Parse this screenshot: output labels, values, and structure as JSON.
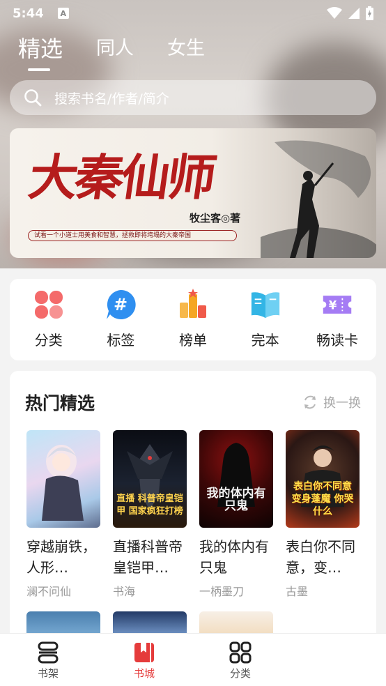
{
  "status_bar": {
    "time": "5:44",
    "notification_icon": "A"
  },
  "top_tabs": [
    {
      "label": "精选",
      "active": true
    },
    {
      "label": "同人",
      "active": false
    },
    {
      "label": "女生",
      "active": false
    }
  ],
  "search": {
    "placeholder": "搜索书名/作者/简介"
  },
  "banner": {
    "title": "大秦仙师",
    "author": "牧尘客◎著",
    "slogan": "试看一个小道士用美食和智慧，拯救即将垮塌的大秦帝国"
  },
  "quick_entries": [
    {
      "label": "分类",
      "icon": "clover-icon",
      "color": "#f25b5b"
    },
    {
      "label": "标签",
      "icon": "hashtag-icon",
      "color": "#2f8ff0"
    },
    {
      "label": "榜单",
      "icon": "ranking-icon",
      "color": "#f5a623"
    },
    {
      "label": "完本",
      "icon": "open-book-icon",
      "color": "#33b5e5"
    },
    {
      "label": "畅读卡",
      "icon": "ticket-icon",
      "color": "#9b6cf2"
    }
  ],
  "hot": {
    "title": "热门精选",
    "refresh_label": "换一换",
    "books": [
      {
        "title": "穿越崩铁，人形…",
        "author": "澜不问仙",
        "cover_text": ""
      },
      {
        "title": "直播科普帝皇铠甲…",
        "author": "书海",
        "cover_text": "直播 科普帝皇铠甲 国家疯狂打榜"
      },
      {
        "title": "我的体内有只鬼",
        "author": "一柄墨刀",
        "cover_text": "我的体内有只鬼"
      },
      {
        "title": "表白你不同意，变…",
        "author": "古墨",
        "cover_text": "表白你不同意 变身蓬魔 你哭什么"
      }
    ]
  },
  "bottom_nav": [
    {
      "label": "书架",
      "icon": "bookshelf-icon",
      "active": false
    },
    {
      "label": "书城",
      "icon": "bookstore-icon",
      "active": true
    },
    {
      "label": "分类",
      "icon": "category-grid-icon",
      "active": false
    }
  ],
  "colors": {
    "accent": "#e53b3b",
    "text": "#222222",
    "muted": "#999999"
  }
}
